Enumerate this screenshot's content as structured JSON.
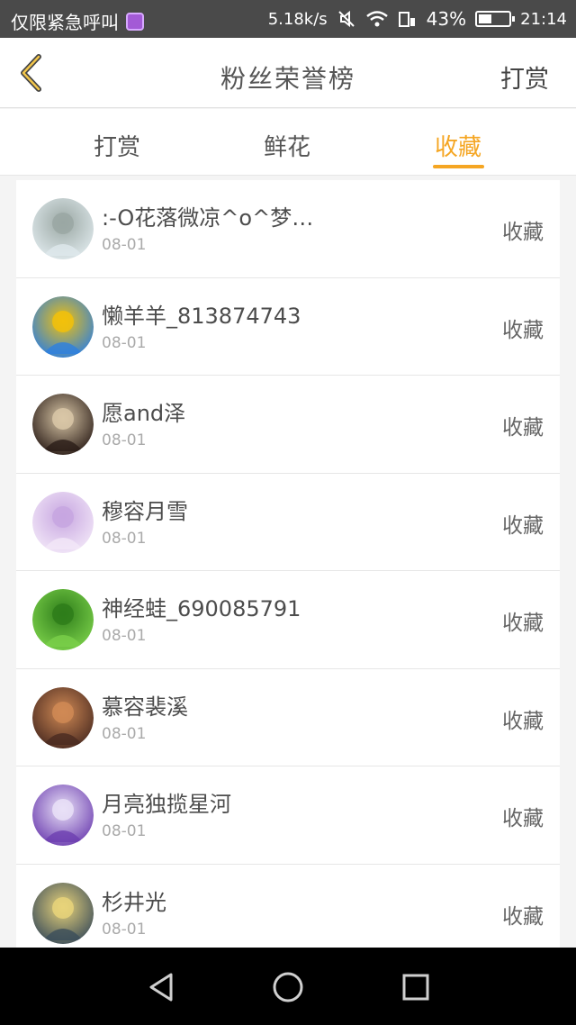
{
  "status_bar": {
    "left_text": "仅限紧急呼叫",
    "net_speed": "5.18k/s",
    "battery_percent": "43%",
    "battery_level": 0.43,
    "time": "21:14"
  },
  "header": {
    "title": "粉丝荣誉榜",
    "action_label": "打赏"
  },
  "tabs": [
    {
      "label": "打赏",
      "active": false
    },
    {
      "label": "鲜花",
      "active": false
    },
    {
      "label": "收藏",
      "active": true
    }
  ],
  "accent_color": "#f5a623",
  "list": {
    "items": [
      {
        "name": ":-O花落微凉^o^梦…",
        "date": "08-01",
        "action": "收藏",
        "avatar_colors": [
          "#dfe9ec",
          "#9aa7a3"
        ]
      },
      {
        "name": "懒羊羊_813874743",
        "date": "08-01",
        "action": "收藏",
        "avatar_colors": [
          "#2d7fe0",
          "#f2c10b"
        ]
      },
      {
        "name": "愿and泽",
        "date": "08-01",
        "action": "收藏",
        "avatar_colors": [
          "#2b1d18",
          "#d9c7a7"
        ]
      },
      {
        "name": "穆容月雪",
        "date": "08-01",
        "action": "收藏",
        "avatar_colors": [
          "#f2e7f8",
          "#c7a6e0"
        ]
      },
      {
        "name": "神经蛙_690085791",
        "date": "08-01",
        "action": "收藏",
        "avatar_colors": [
          "#7bd04a",
          "#2e7d1a"
        ]
      },
      {
        "name": "慕容裴溪",
        "date": "08-01",
        "action": "收藏",
        "avatar_colors": [
          "#4a2a20",
          "#d08a55"
        ]
      },
      {
        "name": "月亮独揽星河",
        "date": "08-01",
        "action": "收藏",
        "avatar_colors": [
          "#6d3fb0",
          "#e9e1f7"
        ]
      },
      {
        "name": "杉井光",
        "date": "08-01",
        "action": "收藏",
        "avatar_colors": [
          "#3b4d5a",
          "#e8d37a"
        ]
      }
    ]
  },
  "nav_bar": {
    "buttons": [
      "back-icon",
      "home-icon",
      "recents-icon"
    ]
  }
}
